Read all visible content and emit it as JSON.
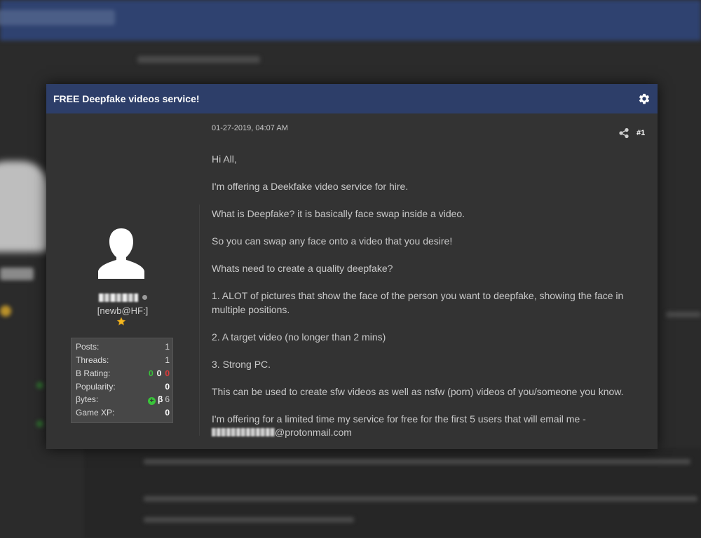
{
  "thread": {
    "title": "FREE Deepfake videos service!"
  },
  "user": {
    "usergroup": "[newb@HF:]",
    "stats": {
      "posts_label": "Posts:",
      "posts_value": "1",
      "threads_label": "Threads:",
      "threads_value": "1",
      "b_rating_label": "B Rating:",
      "b_rating_positive": "0",
      "b_rating_neutral": "0",
      "b_rating_negative": "0",
      "popularity_label": "Popularity:",
      "popularity_value": "0",
      "bytes_label": "βytes:",
      "bytes_plus": "+",
      "bytes_symbol": "β",
      "bytes_value": "6",
      "game_xp_label": "Game XP:",
      "game_xp_value": "0"
    }
  },
  "post": {
    "date": "01-27-2019, 04:07 AM",
    "number": "#1",
    "paragraphs": [
      "Hi All,",
      "I'm offering a Deekfake video service for hire.",
      "What is Deepfake? it is basically face swap inside a video.",
      "So you can swap any face onto a video that you desire!",
      "Whats need to create a quality deepfake?",
      "1. ALOT of pictures that show the face of the person you want to deepfake, showing the face in multiple positions.",
      "2. A target video (no longer than 2 mins)",
      "3. Strong PC.",
      "This can be used to create sfw videos as well as nsfw (porn) videos of you/someone you know."
    ],
    "last_paragraph": "I'm offering for a limited time my service for free for the first 5 users that will email me -",
    "email_domain": "@protonmail.com"
  },
  "icons": {
    "settings": "gear-icon",
    "share": "share-icon",
    "avatar": "default-avatar-icon",
    "star": "star-icon"
  },
  "colors": {
    "header_bg": "#2d3e69",
    "modal_bg": "#333333",
    "rating_positive": "#39c43a",
    "rating_negative": "#e03a3a"
  }
}
